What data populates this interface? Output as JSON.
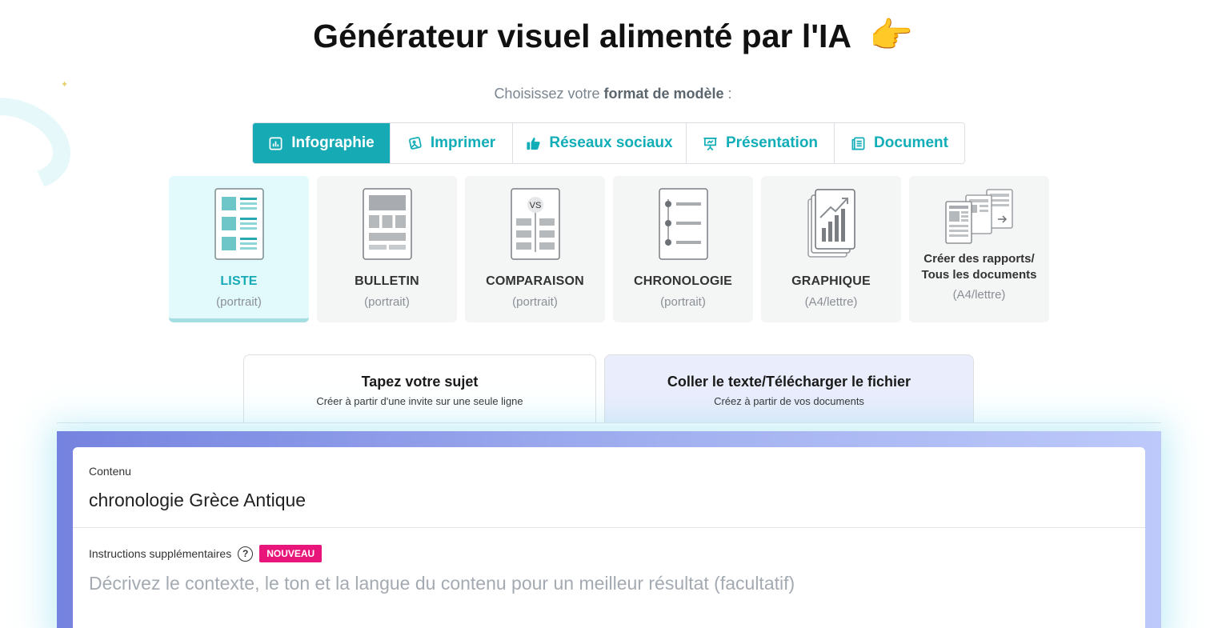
{
  "header": {
    "title": "Générateur visuel alimenté par l'IA",
    "hand_emoji": "👉"
  },
  "format": {
    "prefix": "Choisissez votre",
    "bold": "format de modèle",
    "suffix": ":"
  },
  "tabs": [
    {
      "label": "Infographie",
      "icon": "chart-doc-icon",
      "active": true
    },
    {
      "label": "Imprimer",
      "icon": "image-card-icon",
      "active": false
    },
    {
      "label": "Réseaux sociaux",
      "icon": "thumbs-up-icon",
      "active": false
    },
    {
      "label": "Présentation",
      "icon": "easel-icon",
      "active": false
    },
    {
      "label": "Document",
      "icon": "document-icon",
      "active": false
    }
  ],
  "templates": [
    {
      "name": "LISTE",
      "sub": "(portrait)",
      "active": true
    },
    {
      "name": "BULLETIN",
      "sub": "(portrait)",
      "active": false
    },
    {
      "name": "COMPARAISON",
      "sub": "(portrait)",
      "active": false,
      "badge": "VS"
    },
    {
      "name": "CHRONOLOGIE",
      "sub": "(portrait)",
      "active": false
    },
    {
      "name": "GRAPHIQUE",
      "sub": "(A4/lettre)",
      "active": false
    },
    {
      "name_line1": "Créer des rapports/",
      "name_line2": "Tous les documents",
      "sub": "(A4/lettre)",
      "active": false
    }
  ],
  "modes": {
    "topic": {
      "title": "Tapez votre sujet",
      "sub": "Créer à partir d'une invite sur une seule ligne"
    },
    "paste": {
      "title": "Coller le texte/Télécharger le fichier",
      "sub": "Créez à partir de vos documents"
    }
  },
  "content": {
    "label": "Contenu",
    "value": "chronologie Grèce Antique"
  },
  "instructions": {
    "label": "Instructions supplémentaires",
    "help": "?",
    "badge": "NOUVEAU",
    "placeholder": "Décrivez le contexte, le ton et la langue du contenu pour un meilleur résultat (facultatif)"
  },
  "colors": {
    "accent": "#16aab5",
    "badge": "#e8157a",
    "panel_start": "#7583e0",
    "panel_end": "#bdc9fa"
  }
}
